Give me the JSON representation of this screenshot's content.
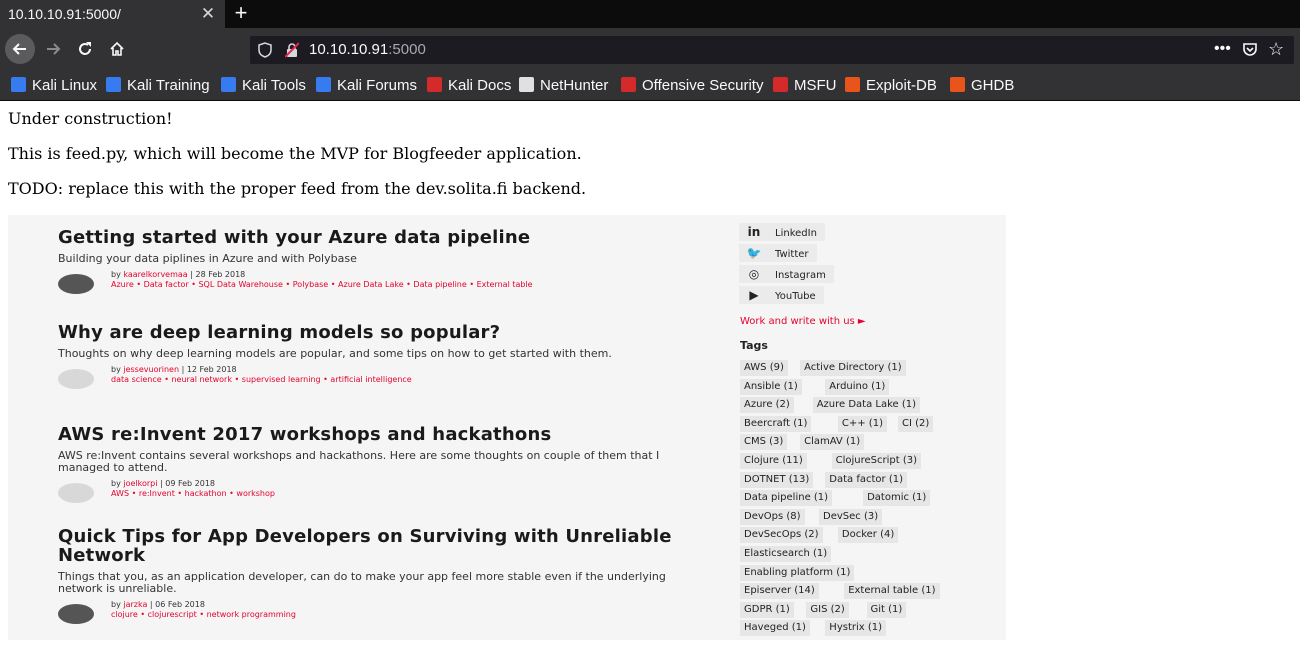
{
  "browser": {
    "tab_title": "10.10.10.91:5000/",
    "tab_close": "✕",
    "new_tab": "+",
    "url_host": "10.10.10.91",
    "url_port": ":5000",
    "more_icon": "•••",
    "star_icon": "☆",
    "bookmarks": [
      {
        "label": "Kali Linux",
        "icon": "kali-dragon-icon",
        "color": "#367bf0"
      },
      {
        "label": "Kali Training",
        "icon": "kali-dragon-icon",
        "color": "#367bf0"
      },
      {
        "label": "Kali Tools",
        "icon": "kali-dragon-icon",
        "color": "#367bf0"
      },
      {
        "label": "Kali Forums",
        "icon": "kali-dragon-icon",
        "color": "#367bf0"
      },
      {
        "label": "Kali Docs",
        "icon": "kali-docs-icon",
        "color": "#d42a2a"
      },
      {
        "label": "NetHunter",
        "icon": "kali-dragon-icon",
        "color": "#e0e0e0"
      },
      {
        "label": "Offensive Security",
        "icon": "offsec-icon",
        "color": "#d42a2a"
      },
      {
        "label": "MSFU",
        "icon": "msfu-icon",
        "color": "#d42a2a"
      },
      {
        "label": "Exploit-DB",
        "icon": "exploitdb-icon",
        "color": "#e8541a"
      },
      {
        "label": "GHDB",
        "icon": "exploitdb-icon",
        "color": "#e8541a"
      }
    ]
  },
  "page": {
    "line1": "Under construction!",
    "line2": "This is feed.py, which will become the MVP for Blogfeeder application.",
    "line3": "TODO: replace this with the proper feed from the dev.solita.fi backend."
  },
  "screenshot": {
    "posts": [
      {
        "title": "Getting started with your Azure data pipeline",
        "subtitle": "Building your data piplines in Azure and with Polybase",
        "by": "by",
        "author": "kaarelkorvemaa",
        "date": "28 Feb 2018",
        "tags": "Azure  •  Data factor  •  SQL Data Warehouse  •  Polybase  •  Azure Data Lake  •  Data pipeline  •  External table",
        "avatar": "photo"
      },
      {
        "title": "Why are deep learning models so popular?",
        "subtitle": "Thoughts on why deep learning models are popular, and some tips on how to get started with them.",
        "by": "by",
        "author": "jessevuorinen",
        "date": "12 Feb 2018",
        "tags": "data science  •  neural network  •  supervised learning  •  artificial intelligence",
        "avatar": "blank"
      },
      {
        "title": "AWS re:Invent 2017 workshops and hackathons",
        "subtitle": "AWS re:Invent contains several workshops and hackathons. Here are some thoughts on couple of them that I managed to attend.",
        "by": "by",
        "author": "joelkorpi",
        "date": "09 Feb 2018",
        "tags": "AWS  •  re:Invent  •  hackathon  •  workshop",
        "avatar": "blank"
      },
      {
        "title": "Quick Tips for App Developers on Surviving with Unreliable Network",
        "subtitle": "Things that you, as an application developer, can do to make your app feel more stable even if the underlying network is unreliable.",
        "by": "by",
        "author": "jarzka",
        "date": "06 Feb 2018",
        "tags": "clojure  •  clojurescript  •  network programming",
        "avatar": "photo"
      }
    ],
    "social": [
      {
        "label": "LinkedIn",
        "glyph": "in"
      },
      {
        "label": "Twitter",
        "glyph": "🐦"
      },
      {
        "label": "Instagram",
        "glyph": "◎"
      },
      {
        "label": "YouTube",
        "glyph": "▶"
      }
    ],
    "work_link": "Work and write with us  ►",
    "tags_heading": "Tags",
    "tags": [
      [
        "AWS (9)",
        "Active Directory (1)"
      ],
      [
        "Ansible (1)",
        "Arduino (1)"
      ],
      [
        "Azure (2)",
        "Azure Data Lake (1)"
      ],
      [
        "Beercraft (1)",
        "C++ (1)",
        "CI (2)"
      ],
      [
        "CMS (3)",
        "ClamAV (1)"
      ],
      [
        "Clojure (11)",
        "ClojureScript (3)"
      ],
      [
        "DOTNET (13)",
        "Data factor (1)"
      ],
      [
        "Data pipeline (1)",
        "Datomic (1)"
      ],
      [
        "DevOps (8)",
        "DevSec (3)"
      ],
      [
        "DevSecOps (2)",
        "Docker (4)"
      ],
      [
        "Elasticsearch (1)"
      ],
      [
        "Enabling platform (1)"
      ],
      [
        "Episerver (14)",
        "External table (1)"
      ],
      [
        "GDPR (1)",
        "GIS (2)",
        "Git (1)"
      ],
      [
        "Haveged (1)",
        "Hystrix (1)"
      ]
    ]
  }
}
